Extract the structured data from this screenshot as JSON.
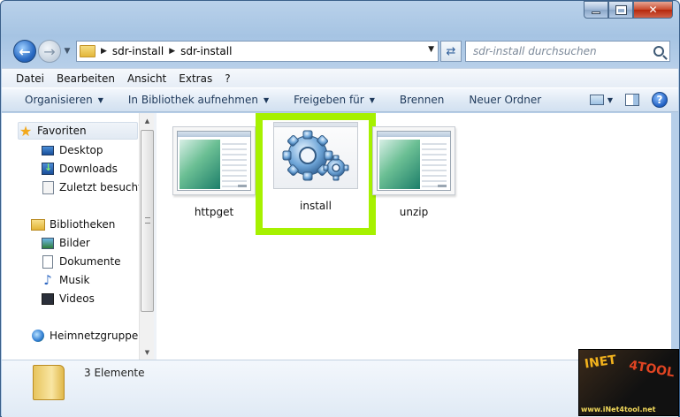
{
  "window": {
    "title": ""
  },
  "navigation": {
    "path": [
      "sdr-install",
      "sdr-install"
    ],
    "search_placeholder": "sdr-install durchsuchen"
  },
  "menu": [
    "Datei",
    "Bearbeiten",
    "Ansicht",
    "Extras",
    "?"
  ],
  "commands": [
    "Organisieren",
    "In Bibliothek aufnehmen",
    "Freigeben für",
    "Brennen",
    "Neuer Ordner"
  ],
  "nav_pane": {
    "favorites_label": "Favoriten",
    "favorites": [
      "Desktop",
      "Downloads",
      "Zuletzt besucht"
    ],
    "libraries_label": "Bibliotheken",
    "libraries": [
      "Bilder",
      "Dokumente",
      "Musik",
      "Videos"
    ],
    "homegroup_label": "Heimnetzgruppe"
  },
  "files": [
    {
      "name": "httpget",
      "icon": "application-thumbnail"
    },
    {
      "name": "install",
      "icon": "gears-icon",
      "selected": true
    },
    {
      "name": "unzip",
      "icon": "application-thumbnail"
    }
  ],
  "status": {
    "item_count": "3 Elemente"
  },
  "watermark": {
    "line1": "INET",
    "line2": "4TOOL",
    "url": "www.iNet4tool.net"
  },
  "colors": {
    "highlight": "#a6f100",
    "frame": "#b9d1ea"
  }
}
